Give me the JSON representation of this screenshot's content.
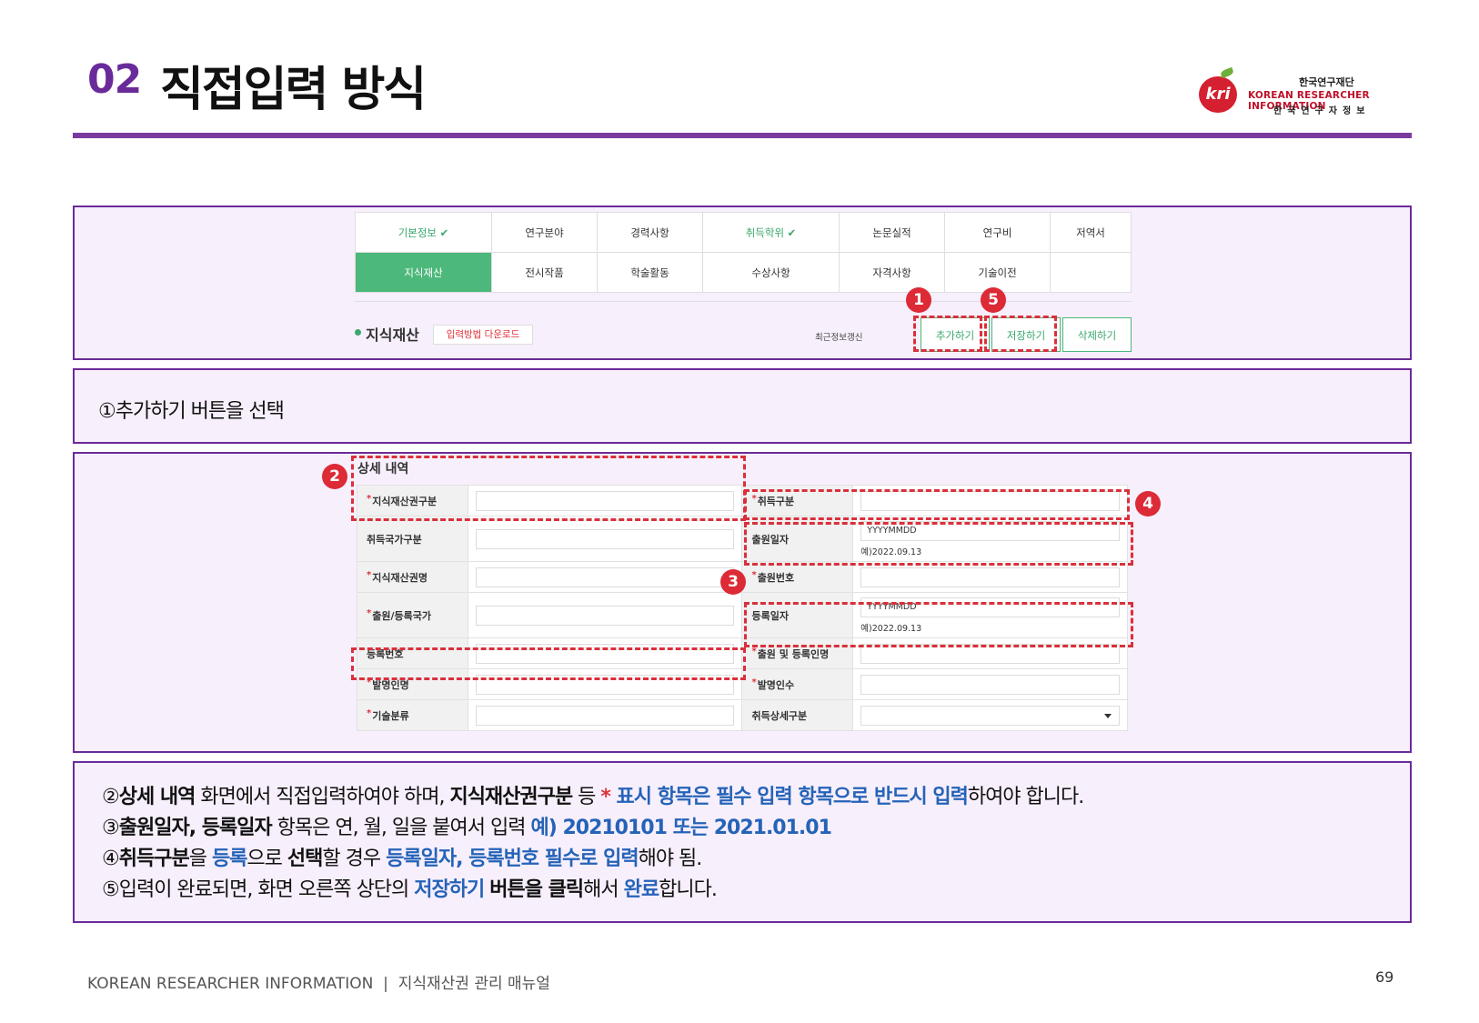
{
  "header": {
    "number": "02",
    "title": "직접입력 방식"
  },
  "logo": {
    "mark": "kri",
    "name_ko": "한국연구재단",
    "name_en": "KOREAN RESEARCHER INFORMATION",
    "name_sub": "한국연구자정보"
  },
  "tabs": {
    "row1": [
      "기본정보 ✔",
      "연구분야",
      "경력사항",
      "취득학위 ✔",
      "논문실적",
      "연구비",
      "저역서"
    ],
    "row2": [
      "지식재산",
      "전시작품",
      "학술활동",
      "수상사항",
      "자격사항",
      "기술이전",
      ""
    ]
  },
  "section": {
    "title": "지식재산",
    "download": "입력방법 다운로드",
    "recent": "최근정보갱신",
    "add": "추가하기",
    "save": "저장하기",
    "delete": "삭제하기"
  },
  "badges": [
    "1",
    "2",
    "3",
    "4",
    "5"
  ],
  "step1": "①추가하기 버튼을 선택",
  "detail": {
    "title": "상세 내역",
    "labels": {
      "ip_type": "지식재산권구분",
      "acq_type": "취득구분",
      "acq_country_type": "취득국가구분",
      "app_date": "출원일자",
      "ip_name": "지식재산권명",
      "app_no": "출원번호",
      "app_country": "출원/등록국가",
      "reg_date": "등록일자",
      "reg_no": "등록번호",
      "applicant": "출원 및 등록인명",
      "inventor": "발명인명",
      "inventor_count": "발명인수",
      "tech_class": "기술분류",
      "acq_detail": "취득상세구분"
    },
    "date_placeholder": "YYYYMMDD",
    "date_example": "예)2022.09.13"
  },
  "notes": {
    "n2": {
      "a": "②",
      "b": "상세 내역",
      "c": " 화면에서 직접입력하여야 하며, ",
      "d": "지식재산권구분",
      "e": " 등 ",
      "f": "*",
      "g": " 표시 항목은 필수 입력 항목으로 반드시 입력",
      "h": "하여야 합니다."
    },
    "n3": {
      "a": "③",
      "b": "출원일자, 등록일자",
      "c": " 항목은 연, 월, 일을 붙여서 입력 ",
      "d": "예) 20210101 또는 2021.01.01"
    },
    "n4": {
      "a": "④",
      "b": "취득구분",
      "c": "을 ",
      "d": "등록",
      "e": "으로 ",
      "f": "선택",
      "g": "할 경우 ",
      "h": "등록일자, 등록번호 필수로 입력",
      "i": "해야 됨."
    },
    "n5": {
      "a": "⑤입력이 완료되면, 화면 오른쪽 상단의 ",
      "b": "저장하기",
      "c": " ",
      "d": "버튼을 클릭",
      "e": "해서 ",
      "f": "완료",
      "g": "합니다."
    }
  },
  "footer": {
    "text": "KOREAN RESEARCHER INFORMATION  |  지식재산권 관리 매뉴얼",
    "page": "69"
  },
  "colors": {
    "accent": "#6a2b9a",
    "green": "#4cb87b",
    "red": "#dc2a36",
    "blue": "#2563b8"
  }
}
